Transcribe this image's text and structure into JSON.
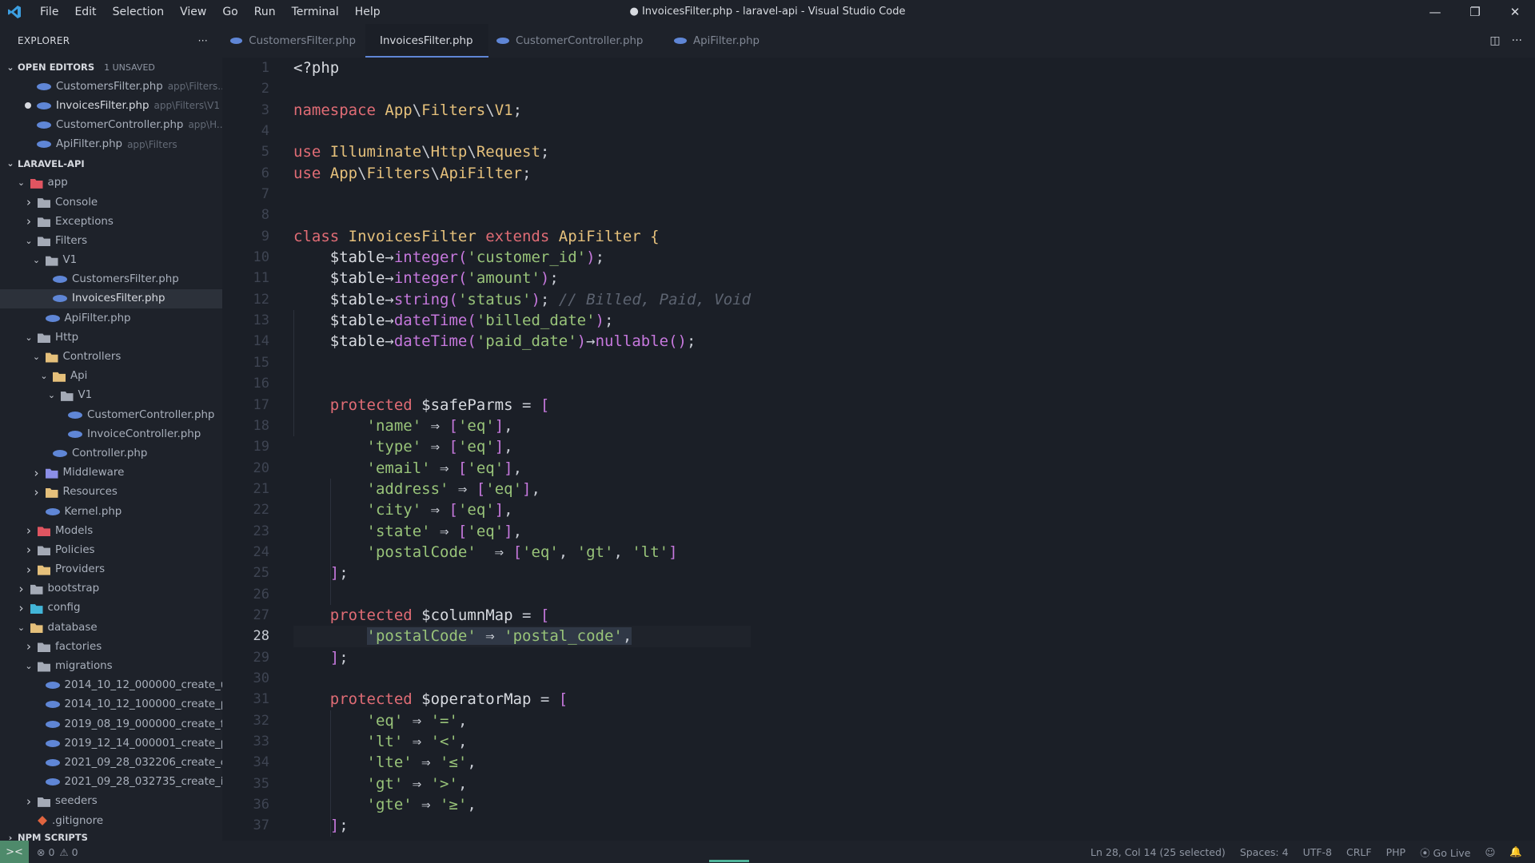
{
  "titlebar": {
    "menu": [
      "File",
      "Edit",
      "Selection",
      "View",
      "Go",
      "Run",
      "Terminal",
      "Help"
    ],
    "title": "● InvoicesFilter.php - laravel-api - Visual Studio Code",
    "minimize": "—",
    "restore": "❐",
    "close": "✕"
  },
  "explorer": {
    "header": "EXPLORER",
    "more": "···",
    "open_editors": {
      "label": "OPEN EDITORS",
      "badge": "1 UNSAVED",
      "items": [
        {
          "name": "CustomersFilter.php",
          "path": "app\\Filters..."
        },
        {
          "name": "InvoicesFilter.php",
          "path": "app\\Filters\\V1"
        },
        {
          "name": "CustomerController.php",
          "path": "app\\H..."
        },
        {
          "name": "ApiFilter.php",
          "path": "app\\Filters"
        }
      ]
    },
    "project": {
      "label": "LARAVEL-API",
      "tree": [
        {
          "label": "app",
          "depth": 1,
          "chev": "v",
          "icon": "folder red"
        },
        {
          "label": "Console",
          "depth": 2,
          "chev": ">",
          "icon": "folder"
        },
        {
          "label": "Exceptions",
          "depth": 2,
          "chev": ">",
          "icon": "folder"
        },
        {
          "label": "Filters",
          "depth": 2,
          "chev": "v",
          "icon": "folder"
        },
        {
          "label": "V1",
          "depth": 3,
          "chev": "v",
          "icon": "folder"
        },
        {
          "label": "CustomersFilter.php",
          "depth": 4,
          "chev": "",
          "icon": "php"
        },
        {
          "label": "InvoicesFilter.php",
          "depth": 4,
          "chev": "",
          "icon": "php",
          "active": true
        },
        {
          "label": "ApiFilter.php",
          "depth": 3,
          "chev": "",
          "icon": "php"
        },
        {
          "label": "Http",
          "depth": 2,
          "chev": "v",
          "icon": "folder"
        },
        {
          "label": "Controllers",
          "depth": 3,
          "chev": "v",
          "icon": "folder yellow"
        },
        {
          "label": "Api",
          "depth": 4,
          "chev": "v",
          "icon": "folder yellow"
        },
        {
          "label": "V1",
          "depth": 5,
          "chev": "v",
          "icon": "folder"
        },
        {
          "label": "CustomerController.php",
          "depth": 6,
          "chev": "",
          "icon": "php"
        },
        {
          "label": "InvoiceController.php",
          "depth": 6,
          "chev": "",
          "icon": "php"
        },
        {
          "label": "Controller.php",
          "depth": 4,
          "chev": "",
          "icon": "php"
        },
        {
          "label": "Middleware",
          "depth": 3,
          "chev": ">",
          "icon": "folder purple"
        },
        {
          "label": "Resources",
          "depth": 3,
          "chev": ">",
          "icon": "folder yellow"
        },
        {
          "label": "Kernel.php",
          "depth": 3,
          "chev": "",
          "icon": "php"
        },
        {
          "label": "Models",
          "depth": 2,
          "chev": ">",
          "icon": "folder red"
        },
        {
          "label": "Policies",
          "depth": 2,
          "chev": ">",
          "icon": "folder"
        },
        {
          "label": "Providers",
          "depth": 2,
          "chev": ">",
          "icon": "folder yellow"
        },
        {
          "label": "bootstrap",
          "depth": 1,
          "chev": ">",
          "icon": "folder"
        },
        {
          "label": "config",
          "depth": 1,
          "chev": ">",
          "icon": "folder teal"
        },
        {
          "label": "database",
          "depth": 1,
          "chev": "v",
          "icon": "folder yellow"
        },
        {
          "label": "factories",
          "depth": 2,
          "chev": ">",
          "icon": "folder"
        },
        {
          "label": "migrations",
          "depth": 2,
          "chev": "v",
          "icon": "folder"
        },
        {
          "label": "2014_10_12_000000_create_u...",
          "depth": 3,
          "chev": "",
          "icon": "php"
        },
        {
          "label": "2014_10_12_100000_create_p...",
          "depth": 3,
          "chev": "",
          "icon": "php"
        },
        {
          "label": "2019_08_19_000000_create_f...",
          "depth": 3,
          "chev": "",
          "icon": "php"
        },
        {
          "label": "2019_12_14_000001_create_p...",
          "depth": 3,
          "chev": "",
          "icon": "php"
        },
        {
          "label": "2021_09_28_032206_create_c...",
          "depth": 3,
          "chev": "",
          "icon": "php"
        },
        {
          "label": "2021_09_28_032735_create_i...",
          "depth": 3,
          "chev": "",
          "icon": "php"
        },
        {
          "label": "seeders",
          "depth": 2,
          "chev": ">",
          "icon": "folder"
        },
        {
          "label": ".gitignore",
          "depth": 2,
          "chev": "",
          "icon": "gitignore"
        }
      ]
    },
    "npm_scripts": "NPM SCRIPTS"
  },
  "tabs": [
    {
      "label": "CustomersFilter.php",
      "active": false
    },
    {
      "label": "InvoicesFilter.php",
      "active": true,
      "unsaved": true
    },
    {
      "label": "CustomerController.php",
      "active": false
    },
    {
      "label": "ApiFilter.php",
      "active": false
    }
  ],
  "editor": {
    "current_line": 28,
    "line_numbers": [
      "1",
      "2",
      "3",
      "4",
      "5",
      "6",
      "7",
      "8",
      "9",
      "10",
      "11",
      "12",
      "13",
      "14",
      "15",
      "16",
      "17",
      "18",
      "19",
      "20",
      "21",
      "22",
      "23",
      "24",
      "25",
      "26",
      "27",
      "28",
      "29",
      "30",
      "31",
      "32",
      "33",
      "34",
      "35",
      "36",
      "37"
    ],
    "lines": [
      [
        [
          "tag",
          "<?php"
        ]
      ],
      [],
      [
        [
          "kw",
          "namespace "
        ],
        [
          "cls",
          "App"
        ],
        [
          "pun",
          "\\"
        ],
        [
          "cls",
          "Filters"
        ],
        [
          "pun",
          "\\"
        ],
        [
          "cls",
          "V1"
        ],
        [
          "pun",
          ";"
        ]
      ],
      [],
      [
        [
          "kw",
          "use "
        ],
        [
          "cls",
          "Illuminate"
        ],
        [
          "pun",
          "\\"
        ],
        [
          "cls",
          "Http"
        ],
        [
          "pun",
          "\\"
        ],
        [
          "cls",
          "Request"
        ],
        [
          "pun",
          ";"
        ]
      ],
      [
        [
          "kw",
          "use "
        ],
        [
          "cls",
          "App"
        ],
        [
          "pun",
          "\\"
        ],
        [
          "cls",
          "Filters"
        ],
        [
          "pun",
          "\\"
        ],
        [
          "cls",
          "ApiFilter"
        ],
        [
          "pun",
          ";"
        ]
      ],
      [],
      [],
      [
        [
          "kw",
          "class "
        ],
        [
          "cls",
          "InvoicesFilter "
        ],
        [
          "kw",
          "extends "
        ],
        [
          "cls",
          "ApiFilter "
        ],
        [
          "cls",
          "{"
        ]
      ],
      [
        [
          "pun",
          "    "
        ],
        [
          "var",
          "$table"
        ],
        [
          "op",
          "→"
        ],
        [
          "fn",
          "integer"
        ],
        [
          "br",
          "("
        ],
        [
          "str",
          "'customer_id'"
        ],
        [
          "br",
          ")"
        ],
        [
          "pun",
          ";"
        ]
      ],
      [
        [
          "pun",
          "    "
        ],
        [
          "var",
          "$table"
        ],
        [
          "op",
          "→"
        ],
        [
          "fn",
          "integer"
        ],
        [
          "br",
          "("
        ],
        [
          "str",
          "'amount'"
        ],
        [
          "br",
          ")"
        ],
        [
          "pun",
          ";"
        ]
      ],
      [
        [
          "pun",
          "    "
        ],
        [
          "var",
          "$table"
        ],
        [
          "op",
          "→"
        ],
        [
          "fn",
          "string"
        ],
        [
          "br",
          "("
        ],
        [
          "str",
          "'status'"
        ],
        [
          "br",
          ")"
        ],
        [
          "pun",
          "; "
        ],
        [
          "cm",
          "// Billed, Paid, Void"
        ]
      ],
      [
        [
          "pun",
          "    "
        ],
        [
          "var",
          "$table"
        ],
        [
          "op",
          "→"
        ],
        [
          "fn",
          "dateTime"
        ],
        [
          "br",
          "("
        ],
        [
          "str",
          "'billed_date'"
        ],
        [
          "br",
          ")"
        ],
        [
          "pun",
          ";"
        ]
      ],
      [
        [
          "pun",
          "    "
        ],
        [
          "var",
          "$table"
        ],
        [
          "op",
          "→"
        ],
        [
          "fn",
          "dateTime"
        ],
        [
          "br",
          "("
        ],
        [
          "str",
          "'paid_date'"
        ],
        [
          "br",
          ")"
        ],
        [
          "op",
          "→"
        ],
        [
          "fn",
          "nullable"
        ],
        [
          "br",
          "()"
        ],
        [
          "pun",
          ";"
        ]
      ],
      [],
      [],
      [
        [
          "pun",
          "    "
        ],
        [
          "kw",
          "protected "
        ],
        [
          "var",
          "$safeParms "
        ],
        [
          "op",
          "= "
        ],
        [
          "br",
          "["
        ]
      ],
      [
        [
          "pun",
          "        "
        ],
        [
          "str",
          "'name' "
        ],
        [
          "op",
          "⇒ "
        ],
        [
          "br",
          "["
        ],
        [
          "str",
          "'eq'"
        ],
        [
          "br",
          "]"
        ],
        [
          "pun",
          ","
        ]
      ],
      [
        [
          "pun",
          "        "
        ],
        [
          "str",
          "'type' "
        ],
        [
          "op",
          "⇒ "
        ],
        [
          "br",
          "["
        ],
        [
          "str",
          "'eq'"
        ],
        [
          "br",
          "]"
        ],
        [
          "pun",
          ","
        ]
      ],
      [
        [
          "pun",
          "        "
        ],
        [
          "str",
          "'email' "
        ],
        [
          "op",
          "⇒ "
        ],
        [
          "br",
          "["
        ],
        [
          "str",
          "'eq'"
        ],
        [
          "br",
          "]"
        ],
        [
          "pun",
          ","
        ]
      ],
      [
        [
          "pun",
          "        "
        ],
        [
          "str",
          "'address' "
        ],
        [
          "op",
          "⇒ "
        ],
        [
          "br",
          "["
        ],
        [
          "str",
          "'eq'"
        ],
        [
          "br",
          "]"
        ],
        [
          "pun",
          ","
        ]
      ],
      [
        [
          "pun",
          "        "
        ],
        [
          "str",
          "'city' "
        ],
        [
          "op",
          "⇒ "
        ],
        [
          "br",
          "["
        ],
        [
          "str",
          "'eq'"
        ],
        [
          "br",
          "]"
        ],
        [
          "pun",
          ","
        ]
      ],
      [
        [
          "pun",
          "        "
        ],
        [
          "str",
          "'state' "
        ],
        [
          "op",
          "⇒ "
        ],
        [
          "br",
          "["
        ],
        [
          "str",
          "'eq'"
        ],
        [
          "br",
          "]"
        ],
        [
          "pun",
          ","
        ]
      ],
      [
        [
          "pun",
          "        "
        ],
        [
          "str",
          "'postalCode'  "
        ],
        [
          "op",
          "⇒ "
        ],
        [
          "br",
          "["
        ],
        [
          "str",
          "'eq'"
        ],
        [
          "pun",
          ", "
        ],
        [
          "str",
          "'gt'"
        ],
        [
          "pun",
          ", "
        ],
        [
          "str",
          "'lt'"
        ],
        [
          "br",
          "]"
        ]
      ],
      [
        [
          "pun",
          "    "
        ],
        [
          "br",
          "]"
        ],
        [
          "pun",
          ";"
        ]
      ],
      [],
      [
        [
          "pun",
          "    "
        ],
        [
          "kw",
          "protected "
        ],
        [
          "var",
          "$columnMap "
        ],
        [
          "op",
          "= "
        ],
        [
          "br",
          "["
        ]
      ],
      [
        [
          "pun",
          "        "
        ],
        [
          "str",
          "'postalCode' "
        ],
        [
          "op",
          "⇒ "
        ],
        [
          "str",
          "'postal_code'"
        ],
        [
          "pun",
          ","
        ]
      ],
      [
        [
          "pun",
          "    "
        ],
        [
          "br",
          "]"
        ],
        [
          "pun",
          ";"
        ]
      ],
      [],
      [
        [
          "pun",
          "    "
        ],
        [
          "kw",
          "protected "
        ],
        [
          "var",
          "$operatorMap "
        ],
        [
          "op",
          "= "
        ],
        [
          "br",
          "["
        ]
      ],
      [
        [
          "pun",
          "        "
        ],
        [
          "str",
          "'eq' "
        ],
        [
          "op",
          "⇒ "
        ],
        [
          "str",
          "'='"
        ],
        [
          "pun",
          ","
        ]
      ],
      [
        [
          "pun",
          "        "
        ],
        [
          "str",
          "'lt' "
        ],
        [
          "op",
          "⇒ "
        ],
        [
          "str",
          "'<'"
        ],
        [
          "pun",
          ","
        ]
      ],
      [
        [
          "pun",
          "        "
        ],
        [
          "str",
          "'lte' "
        ],
        [
          "op",
          "⇒ "
        ],
        [
          "str",
          "'≤'"
        ],
        [
          "pun",
          ","
        ]
      ],
      [
        [
          "pun",
          "        "
        ],
        [
          "str",
          "'gt' "
        ],
        [
          "op",
          "⇒ "
        ],
        [
          "str",
          "'>'"
        ],
        [
          "pun",
          ","
        ]
      ],
      [
        [
          "pun",
          "        "
        ],
        [
          "str",
          "'gte' "
        ],
        [
          "op",
          "⇒ "
        ],
        [
          "str",
          "'≥'"
        ],
        [
          "pun",
          ","
        ]
      ],
      [
        [
          "pun",
          "    "
        ],
        [
          "br",
          "]"
        ],
        [
          "pun",
          ";"
        ]
      ]
    ]
  },
  "statusbar": {
    "remote": "><",
    "errors": "⊗ 0",
    "warnings": "⚠ 0",
    "position": "Ln 28, Col 14 (25 selected)",
    "spaces": "Spaces: 4",
    "encoding": "UTF-8",
    "eol": "CRLF",
    "language": "PHP",
    "golive": "⦿ Go Live",
    "feedback": "☺",
    "bell": "🔔"
  },
  "colors": {
    "background": "#1b1f27",
    "sidebar": "#1e222a",
    "keyword": "#e06c75",
    "class": "#e5c07b",
    "string": "#98c379",
    "function": "#c678dd",
    "accent": "#5f86d6"
  }
}
